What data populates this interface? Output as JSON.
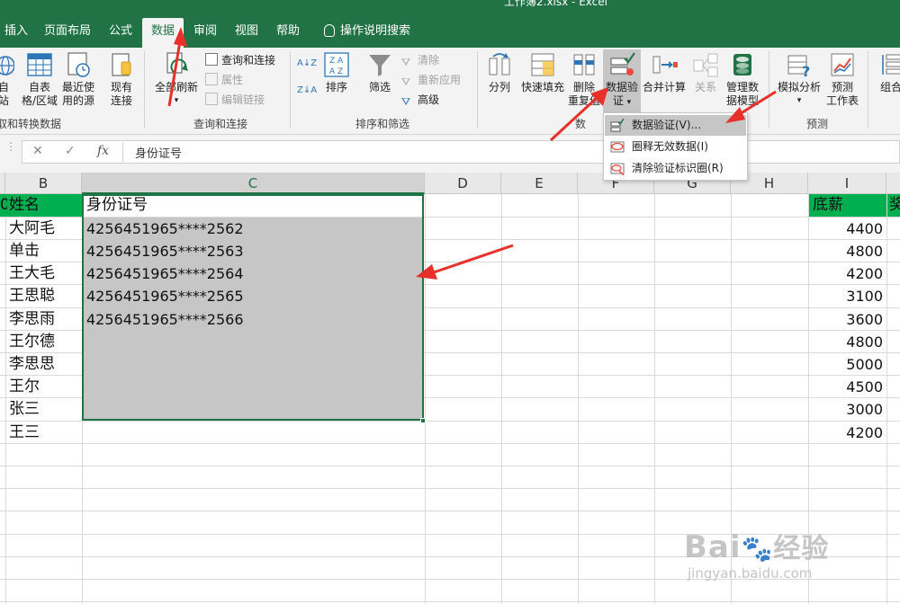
{
  "window": {
    "title": "工作簿2.xlsx  -  Excel"
  },
  "tabs": [
    {
      "label": "插入",
      "active": false
    },
    {
      "label": "页面布局",
      "active": false
    },
    {
      "label": "公式",
      "active": false
    },
    {
      "label": "数据",
      "active": true
    },
    {
      "label": "审阅",
      "active": false
    },
    {
      "label": "视图",
      "active": false
    },
    {
      "label": "帮助",
      "active": false
    },
    {
      "label": "操作说明搜索",
      "active": false
    }
  ],
  "ribbon": {
    "get_data": {
      "from_label": "自\n站",
      "from_table": "自表\n格/区域",
      "recent": "最近使\n用的源",
      "existing": "现有\n连接",
      "group": "取和转换数据"
    },
    "queries": {
      "refresh_all": "全部刷新",
      "queries_connections": "查询和连接",
      "properties": "属性",
      "edit_links": "编辑链接",
      "group": "查询和连接"
    },
    "sort_filter": {
      "sort_az": "A↓Z",
      "sort_za": "Z↓A",
      "sort": "排序",
      "filter": "筛选",
      "clear": "清除",
      "reapply": "重新应用",
      "advanced": "高级",
      "group": "排序和筛选"
    },
    "data_tools": {
      "text_to_columns": "分列",
      "flash_fill": "快速填充",
      "remove_dup": "删除\n重复值",
      "validation": "数据验\n证",
      "consolidate": "合并计算",
      "relationships": "关系",
      "data_model": "管理数\n据模型",
      "group": "数"
    },
    "forecast": {
      "what_if": "模拟分析",
      "forecast_sheet": "预测\n工作表",
      "group": "预测"
    },
    "outline": {
      "group_btn": "组合"
    }
  },
  "dropdown": {
    "items": [
      {
        "label": "数据验证(V)..."
      },
      {
        "label": "圈释无效数据(I)"
      },
      {
        "label": "清除验证标识圈(R)"
      }
    ]
  },
  "formula_bar": {
    "cancel": "✕",
    "enter": "✓",
    "fx": "fx",
    "content": "身份证号"
  },
  "columns": [
    "B",
    "C",
    "D",
    "E",
    "F",
    "G",
    "H",
    "I"
  ],
  "sheet": {
    "header_a_partial": "0",
    "header_b": "姓名",
    "header_c": "身份证号",
    "header_i": "底薪",
    "header_j_partial": "奖",
    "names": [
      "大阿毛",
      "单击",
      "王大毛",
      "王思聪",
      "李思雨",
      "王尔德",
      "李思思",
      "王尔",
      "张三",
      "王三"
    ],
    "ids": [
      "4256451965****2562",
      "4256451965****2563",
      "4256451965****2564",
      "4256451965****2565",
      "4256451965****2566"
    ],
    "salaries": [
      "4400",
      "4800",
      "4200",
      "3100",
      "3600",
      "4800",
      "5000",
      "4500",
      "3000",
      "4200"
    ]
  },
  "watermark": {
    "brand": "Bai",
    "brand2": "经验",
    "url": "jingyan.baidu.com"
  },
  "colors": {
    "excel_green": "#217346",
    "header_green": "#00b050",
    "arrow_red": "#e8302a",
    "selection_gray": "#c6c6c6"
  }
}
